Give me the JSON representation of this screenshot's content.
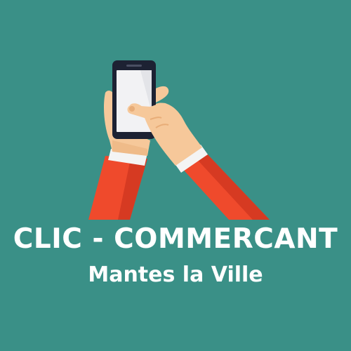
{
  "logo": {
    "title": "CLIC - COMMERCANT",
    "subtitle": "Mantes la Ville"
  },
  "colors": {
    "background": "#3a9087",
    "text": "#ffffff",
    "sleeve": "#ef4a2c",
    "sleeve_shadow": "#d63a22",
    "cuff": "#f4f4f4",
    "skin": "#f6c89a",
    "skin_shadow": "#e8ad78",
    "phone_body": "#1d2233",
    "phone_screen": "#f2f2f4"
  },
  "icons": [
    "hands-holding-smartphone-icon"
  ]
}
